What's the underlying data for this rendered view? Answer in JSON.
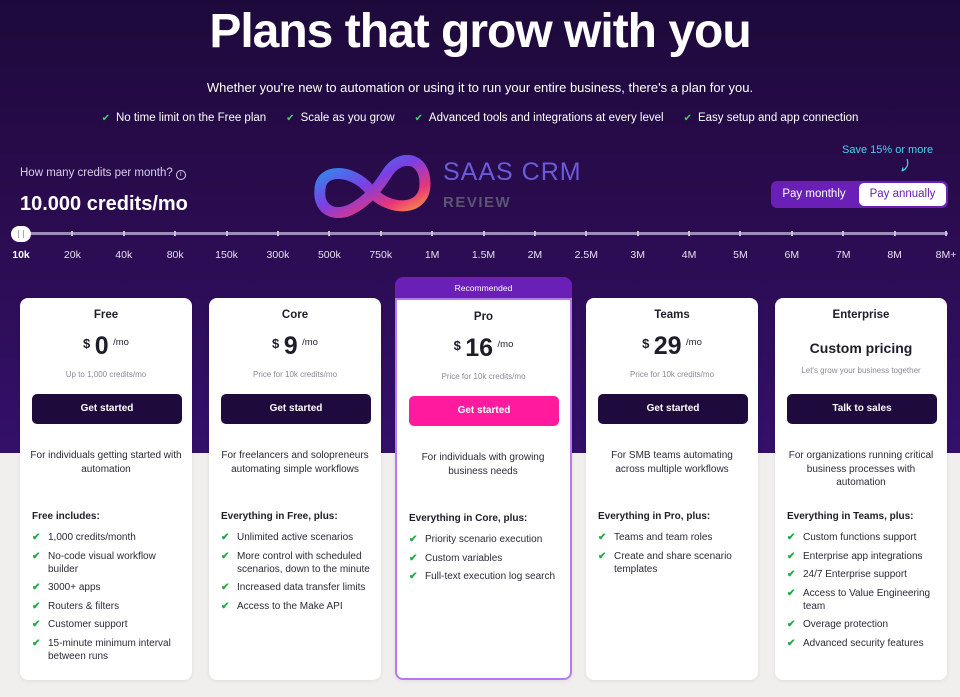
{
  "hero": {
    "title": "Plans that grow with you",
    "subtitle": "Whether you're new to automation or using it to run your entire business, there's a plan for you.",
    "features": [
      "No time limit on the Free plan",
      "Scale as you grow",
      "Advanced tools and integrations at every level",
      "Easy setup and app connection"
    ]
  },
  "credits": {
    "question": "How many credits per month?",
    "value": "10.000 credits/mo",
    "slider_fraction": 0.0,
    "ticks": [
      "10k",
      "20k",
      "40k",
      "80k",
      "150k",
      "300k",
      "500k",
      "750k",
      "1M",
      "1.5M",
      "2M",
      "2.5M",
      "3M",
      "4M",
      "5M",
      "6M",
      "7M",
      "8M",
      "8M+"
    ]
  },
  "logo": {
    "name": "SAAS CRM",
    "tagline": "REVIEW"
  },
  "billing": {
    "save_note": "Save 15% or more",
    "monthly": "Pay monthly",
    "annually": "Pay annually",
    "selected": "annually"
  },
  "recommended_label": "Recommended",
  "plans": [
    {
      "name": "Free",
      "currency": "$",
      "amount": "0",
      "per": "/mo",
      "note": "Up to 1,000 credits/mo",
      "cta": "Get started",
      "description": "For individuals getting started with automation",
      "includes_title": "Free includes:",
      "features": [
        "1,000 credits/month",
        "No-code visual workflow builder",
        "3000+ apps",
        "Routers & filters",
        "Customer support",
        "15-minute minimum interval between runs"
      ]
    },
    {
      "name": "Core",
      "currency": "$",
      "amount": "9",
      "per": "/mo",
      "note": "Price for 10k credits/mo",
      "cta": "Get started",
      "description": "For freelancers and solopreneurs automating simple workflows",
      "includes_title": "Everything in Free, plus:",
      "features": [
        "Unlimited active scenarios",
        "More control with scheduled scenarios, down to the minute",
        "Increased data transfer limits",
        "Access to the Make API"
      ]
    },
    {
      "name": "Pro",
      "currency": "$",
      "amount": "16",
      "per": "/mo",
      "note": "Price for 10k credits/mo",
      "cta": "Get started",
      "description": "For individuals with growing business needs",
      "includes_title": "Everything in Core, plus:",
      "features": [
        "Priority scenario execution",
        "Custom variables",
        "Full-text execution log search"
      ]
    },
    {
      "name": "Teams",
      "currency": "$",
      "amount": "29",
      "per": "/mo",
      "note": "Price for 10k credits/mo",
      "cta": "Get started",
      "description": "For SMB teams automating across multiple workflows",
      "includes_title": "Everything in Pro, plus:",
      "features": [
        "Teams and team roles",
        "Create and share scenario templates"
      ]
    },
    {
      "name": "Enterprise",
      "custom_price": "Custom pricing",
      "note": "Let's grow your business together",
      "cta": "Talk to sales",
      "description": "For organizations running critical business processes with automation",
      "includes_title": "Everything in Teams, plus:",
      "features": [
        "Custom functions support",
        "Enterprise app integrations",
        "24/7 Enterprise support",
        "Access to Value Engineering team",
        "Overage protection",
        "Advanced security features"
      ]
    }
  ]
}
